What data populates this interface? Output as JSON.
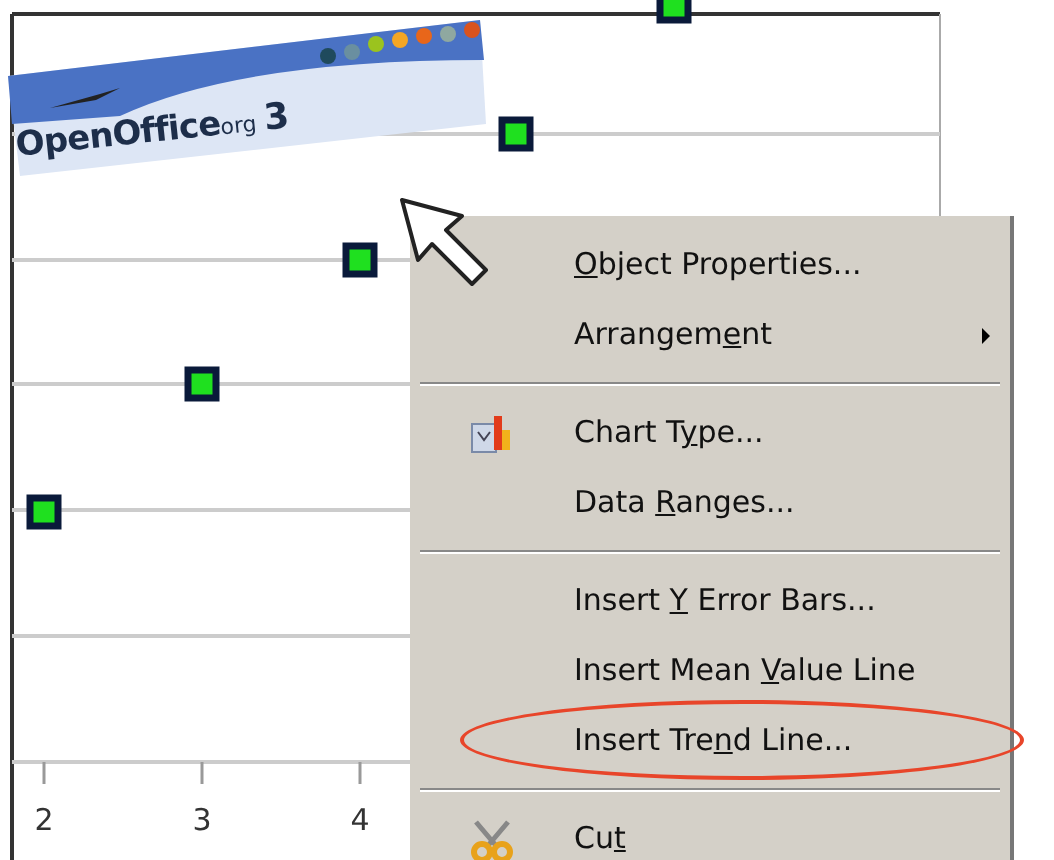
{
  "logo": {
    "name": "OpenOffice",
    "suffix": "org",
    "version": "3"
  },
  "chart": {
    "x_tick_labels": [
      "2",
      "3",
      "4"
    ]
  },
  "context_menu": {
    "items": [
      {
        "kind": "item",
        "label": "Object Properties...",
        "submenu": false,
        "highlighted": false
      },
      {
        "kind": "item",
        "label": "Arrangement",
        "submenu": true,
        "highlighted": false
      },
      {
        "kind": "separator"
      },
      {
        "kind": "item",
        "label": "Chart Type...",
        "submenu": false,
        "highlighted": false
      },
      {
        "kind": "item",
        "label": "Data Ranges...",
        "submenu": false,
        "highlighted": false
      },
      {
        "kind": "separator"
      },
      {
        "kind": "item",
        "label": "Insert Y Error Bars...",
        "submenu": false,
        "highlighted": false
      },
      {
        "kind": "item",
        "label": "Insert Mean Value Line",
        "submenu": false,
        "highlighted": false
      },
      {
        "kind": "item",
        "label": "Insert Trend Line...",
        "submenu": false,
        "highlighted": true
      },
      {
        "kind": "separator"
      },
      {
        "kind": "item",
        "label": "Cut",
        "submenu": false,
        "highlighted": false
      }
    ]
  }
}
